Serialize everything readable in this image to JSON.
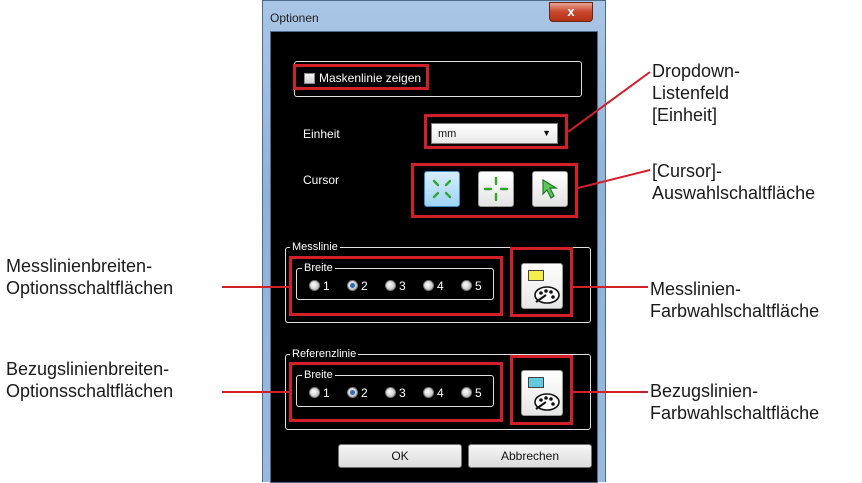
{
  "window": {
    "title": "Optionen",
    "close_symbol": "x"
  },
  "mask": {
    "checkbox_label": "Maskenlinie zeigen",
    "checked": false
  },
  "unit": {
    "label": "Einheit",
    "selected": "mm"
  },
  "cursor": {
    "label": "Cursor",
    "options": [
      "cross-diagonal",
      "cross-plus",
      "arrow"
    ],
    "selected_index": 0
  },
  "measure_line": {
    "group_label": "Messlinie",
    "width_label": "Breite",
    "widths": [
      "1",
      "2",
      "3",
      "4",
      "5"
    ],
    "selected_width": "2",
    "swatch_color": "#f4ef4a"
  },
  "reference_line": {
    "group_label": "Referenzlinie",
    "width_label": "Breite",
    "widths": [
      "1",
      "2",
      "3",
      "4",
      "5"
    ],
    "selected_width": "2",
    "swatch_color": "#63c9dc"
  },
  "buttons": {
    "ok": "OK",
    "cancel": "Abbrechen"
  },
  "annotations": {
    "dropdown": [
      "Dropdown-",
      "Listenfeld",
      "[Einheit]"
    ],
    "cursor": [
      "[Cursor]-",
      "Auswahlschaltfläche"
    ],
    "measure_width": [
      "Messlinienbreiten-",
      "Optionsschaltflächen"
    ],
    "measure_color": [
      "Messlinien-",
      "Farbwahlschaltfläche"
    ],
    "reference_width": [
      "Bezugslinienbreiten-",
      "Optionsschaltflächen"
    ],
    "reference_color": [
      "Bezugslinien-",
      "Farbwahlschaltfläche"
    ]
  },
  "colors": {
    "highlight": "#d21f2a"
  }
}
